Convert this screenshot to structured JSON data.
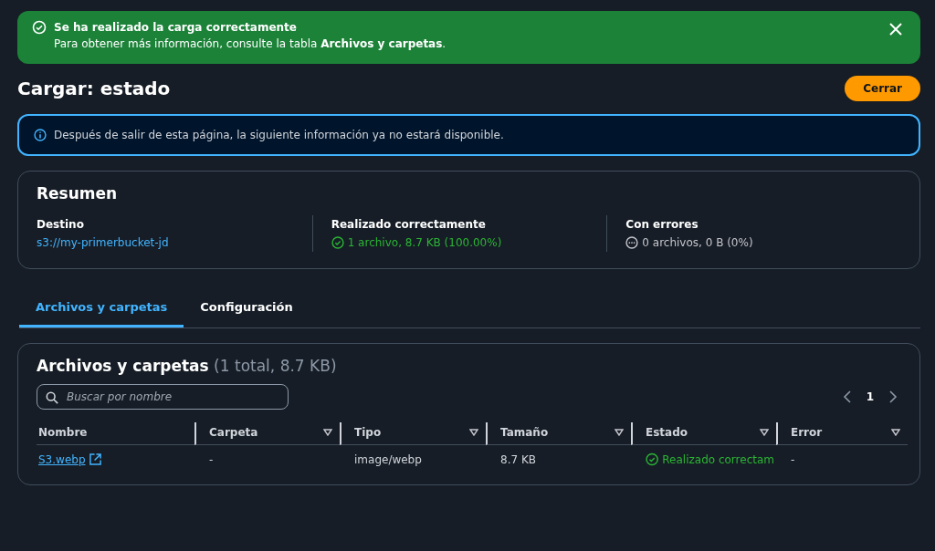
{
  "flash": {
    "kind": "success",
    "title": "Se ha realizado la carga correctamente",
    "message": "Para obtener más información, consulte la tabla **Archivos y carpetas**."
  },
  "header": {
    "title": "Cargar: estado",
    "button": "Cerrar"
  },
  "info": {
    "message": "Después de salir de esta página, la siguiente información ya no estará disponible."
  },
  "summary": {
    "title": "Resumen",
    "items": [
      {
        "label": "Destino",
        "kind": "link",
        "value": "s3://my-primerbucket-jd"
      },
      {
        "label": "Realizado correctamente",
        "kind": "success",
        "value": "1 archivo, 8.7 KB (100.00%)"
      },
      {
        "label": "Con errores",
        "kind": "neutral",
        "value": "0 archivos, 0 B (0%)"
      }
    ]
  },
  "tabs": [
    {
      "label": "Archivos y carpetas",
      "selected": true
    },
    {
      "label": "Configuración",
      "selected": false
    }
  ],
  "table": {
    "title": "Archivos y carpetas",
    "count": "(1 total, 8.7 KB)",
    "search": {
      "placeholder": "Buscar por nombre"
    },
    "page": "1",
    "columns": [
      {
        "label": "Nombre",
        "sortable": false
      },
      {
        "label": "Carpeta",
        "sortable": true
      },
      {
        "label": "Tipo",
        "sortable": true
      },
      {
        "label": "Tamaño",
        "sortable": true
      },
      {
        "label": "Estado",
        "sortable": true
      },
      {
        "label": "Error",
        "sortable": true
      }
    ],
    "rows": [
      {
        "name": "S3.webp",
        "folder": "-",
        "type": "image/webp",
        "size": "8.7 KB",
        "status": {
          "kind": "success",
          "text": "Realizado correctam"
        },
        "error": "-"
      }
    ]
  }
}
